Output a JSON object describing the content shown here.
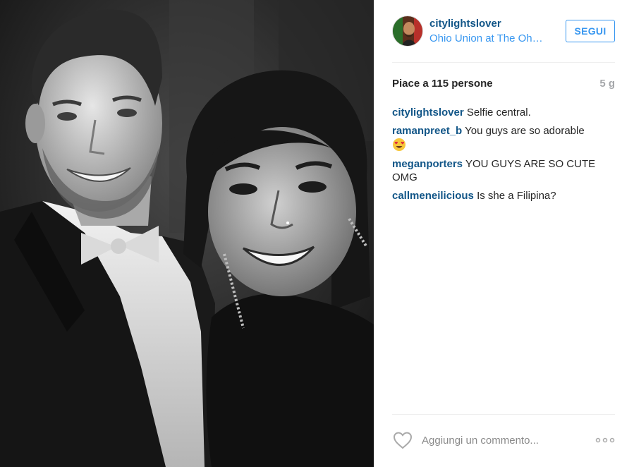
{
  "post": {
    "username": "citylightslover",
    "location": "Ohio Union at The Oh…",
    "follow_label": "SEGUI",
    "likes_text": "Piace a 115 persone",
    "timestamp": "5 g",
    "comments": [
      {
        "user": "citylightslover",
        "text": "Selfie central.",
        "emoji": ""
      },
      {
        "user": "ramanpreet_b",
        "text": "You guys are so adorable",
        "emoji": "heart-eyes-emoji"
      },
      {
        "user": "meganporters",
        "text": "YOU GUYS ARE SO CUTE OMG",
        "emoji": ""
      },
      {
        "user": "callmeneilicious",
        "text": "Is she a Filipina?",
        "emoji": ""
      }
    ],
    "comment_placeholder": "Aggiungi un commento...",
    "icons": {
      "like": "heart-outline-icon",
      "more": "more-options-icon"
    },
    "colors": {
      "username": "#125688",
      "location": "#3897f0",
      "follow_border": "#3897f0",
      "timestamp": "#a5a7aa"
    }
  }
}
